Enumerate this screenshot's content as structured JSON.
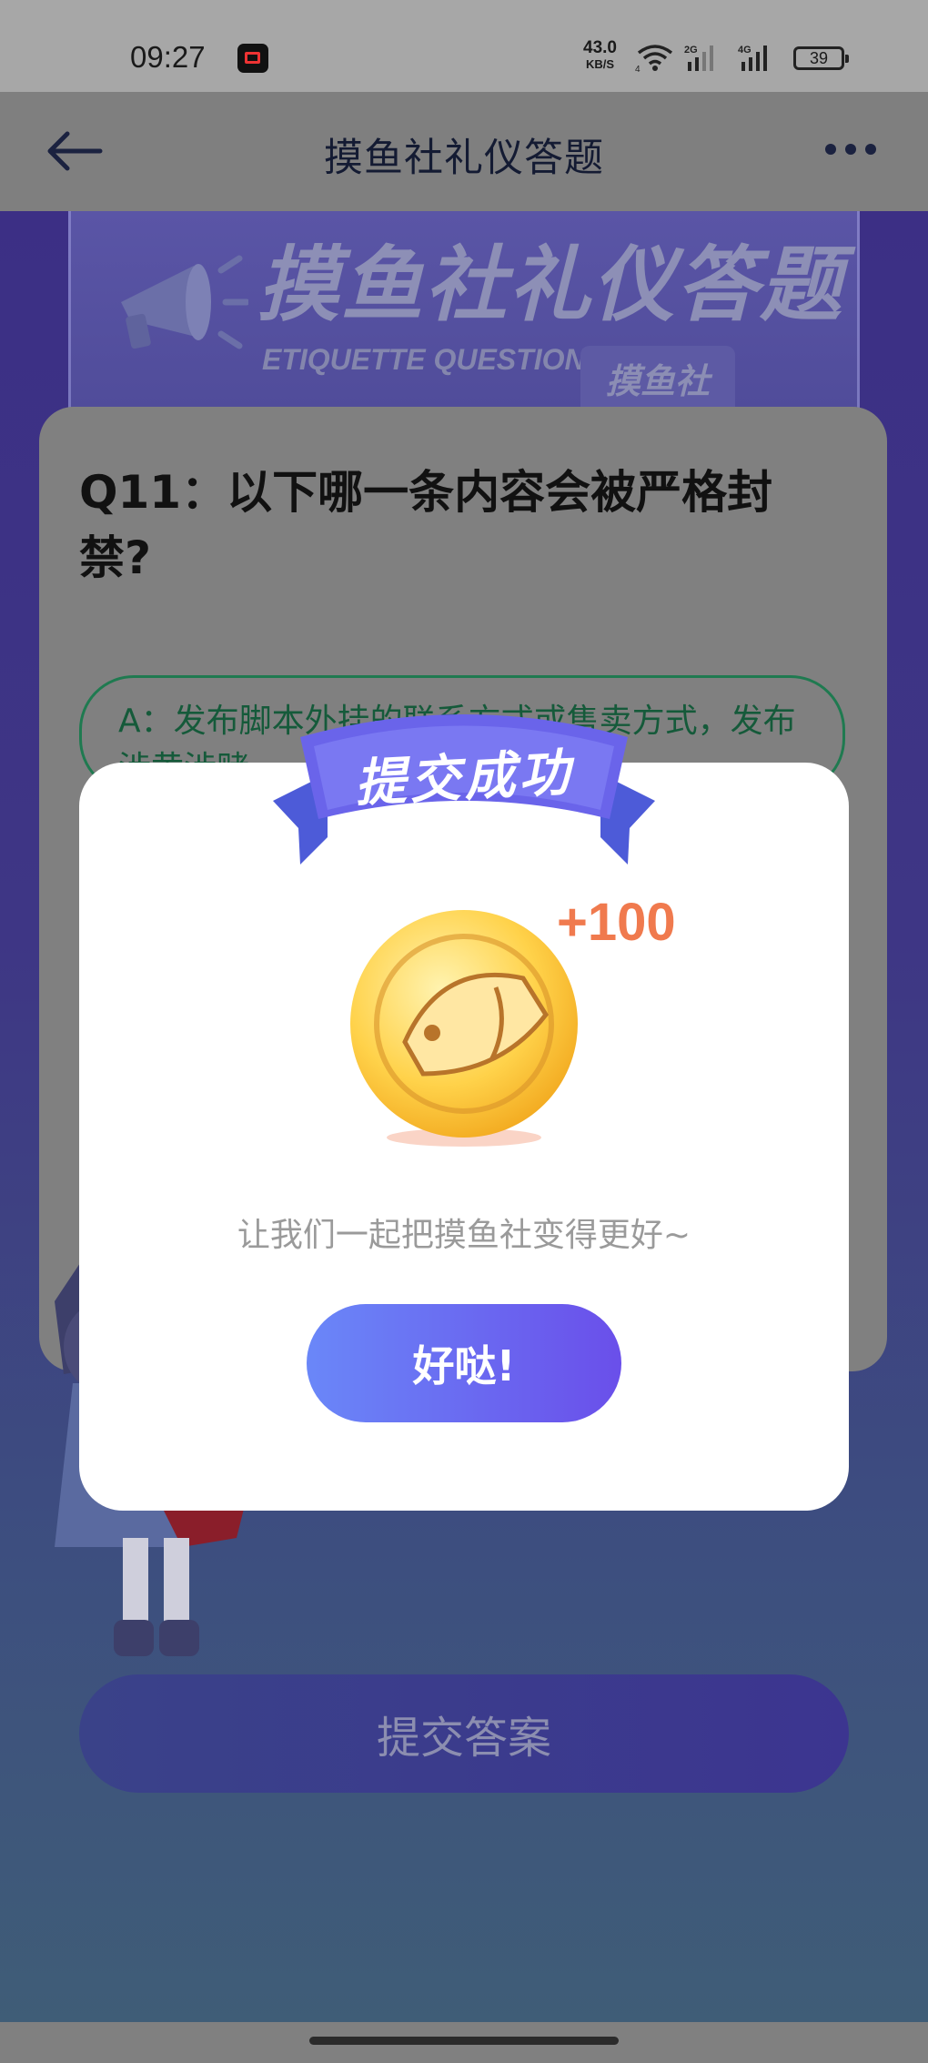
{
  "status_bar": {
    "time": "09:27",
    "net_speed_value": "43.0",
    "net_speed_unit": "KB/S",
    "wifi_label": "4",
    "sim1_label": "2G",
    "sim2_label": "4G",
    "battery": "39"
  },
  "nav": {
    "title": "摸鱼社礼仪答题"
  },
  "banner": {
    "title": "摸鱼社礼仪答题",
    "subtitle_en": "ETIQUETTE QUESTIONS",
    "badge": "摸鱼社"
  },
  "question": {
    "title": "Q11：以下哪一条内容会被严格封禁?",
    "option_a": "A：发布脚本外挂的联系方式或售卖方式，发布涉黄涉赌"
  },
  "submit": {
    "label": "提交答案"
  },
  "dialog": {
    "ribbon_title": "提交成功",
    "points": "+100",
    "message": "让我们一起把摸鱼社变得更好~",
    "ok_label": "好哒!"
  },
  "colors": {
    "accent_purple": "#6a4fea",
    "accent_blue": "#6a87f8",
    "reward_orange": "#f07a4e",
    "option_green": "#1f7a50"
  }
}
